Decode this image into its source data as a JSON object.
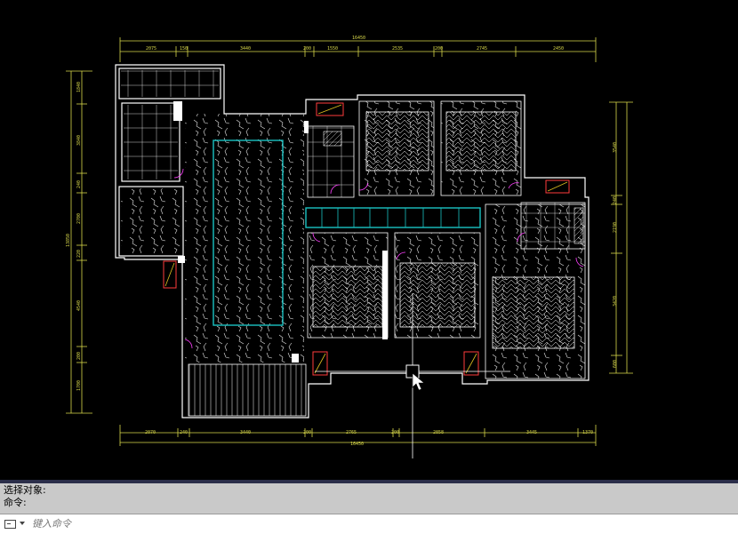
{
  "drawing": {
    "colors": {
      "background": "#000000",
      "wall": "#ffffff",
      "dimension": "#d8d84a",
      "cabinet": "#19c2c2",
      "floor_pattern": "#e8e8e8",
      "accent_red": "#ff3c3c",
      "accent_magenta": "#ff40ff",
      "accent_yellow": "#e0c020"
    },
    "dimensions_top_total": "16450",
    "dimensions_top": [
      "2075",
      "150",
      "3440",
      "200",
      "1550",
      "2535",
      "200",
      "2745",
      "2450"
    ],
    "dimensions_bottom_total": "16450",
    "dimensions_bottom": [
      "2070",
      "240",
      "3440",
      "200",
      "2765",
      "200",
      "2858",
      "3445",
      "1370"
    ],
    "dimensions_left_total": "13850",
    "dimensions_left": [
      "1840",
      "3840",
      "240",
      "2700",
      "220",
      "4540",
      "200",
      "1700"
    ],
    "dimensions_right": [
      "3540",
      "240",
      "2190",
      "3420",
      "600"
    ]
  },
  "command": {
    "history": [
      "选择对象:",
      "命令:"
    ],
    "placeholder": "键入命令",
    "icon": "command-prompt-icon",
    "dropdown_icon": "chevron-down-icon"
  }
}
